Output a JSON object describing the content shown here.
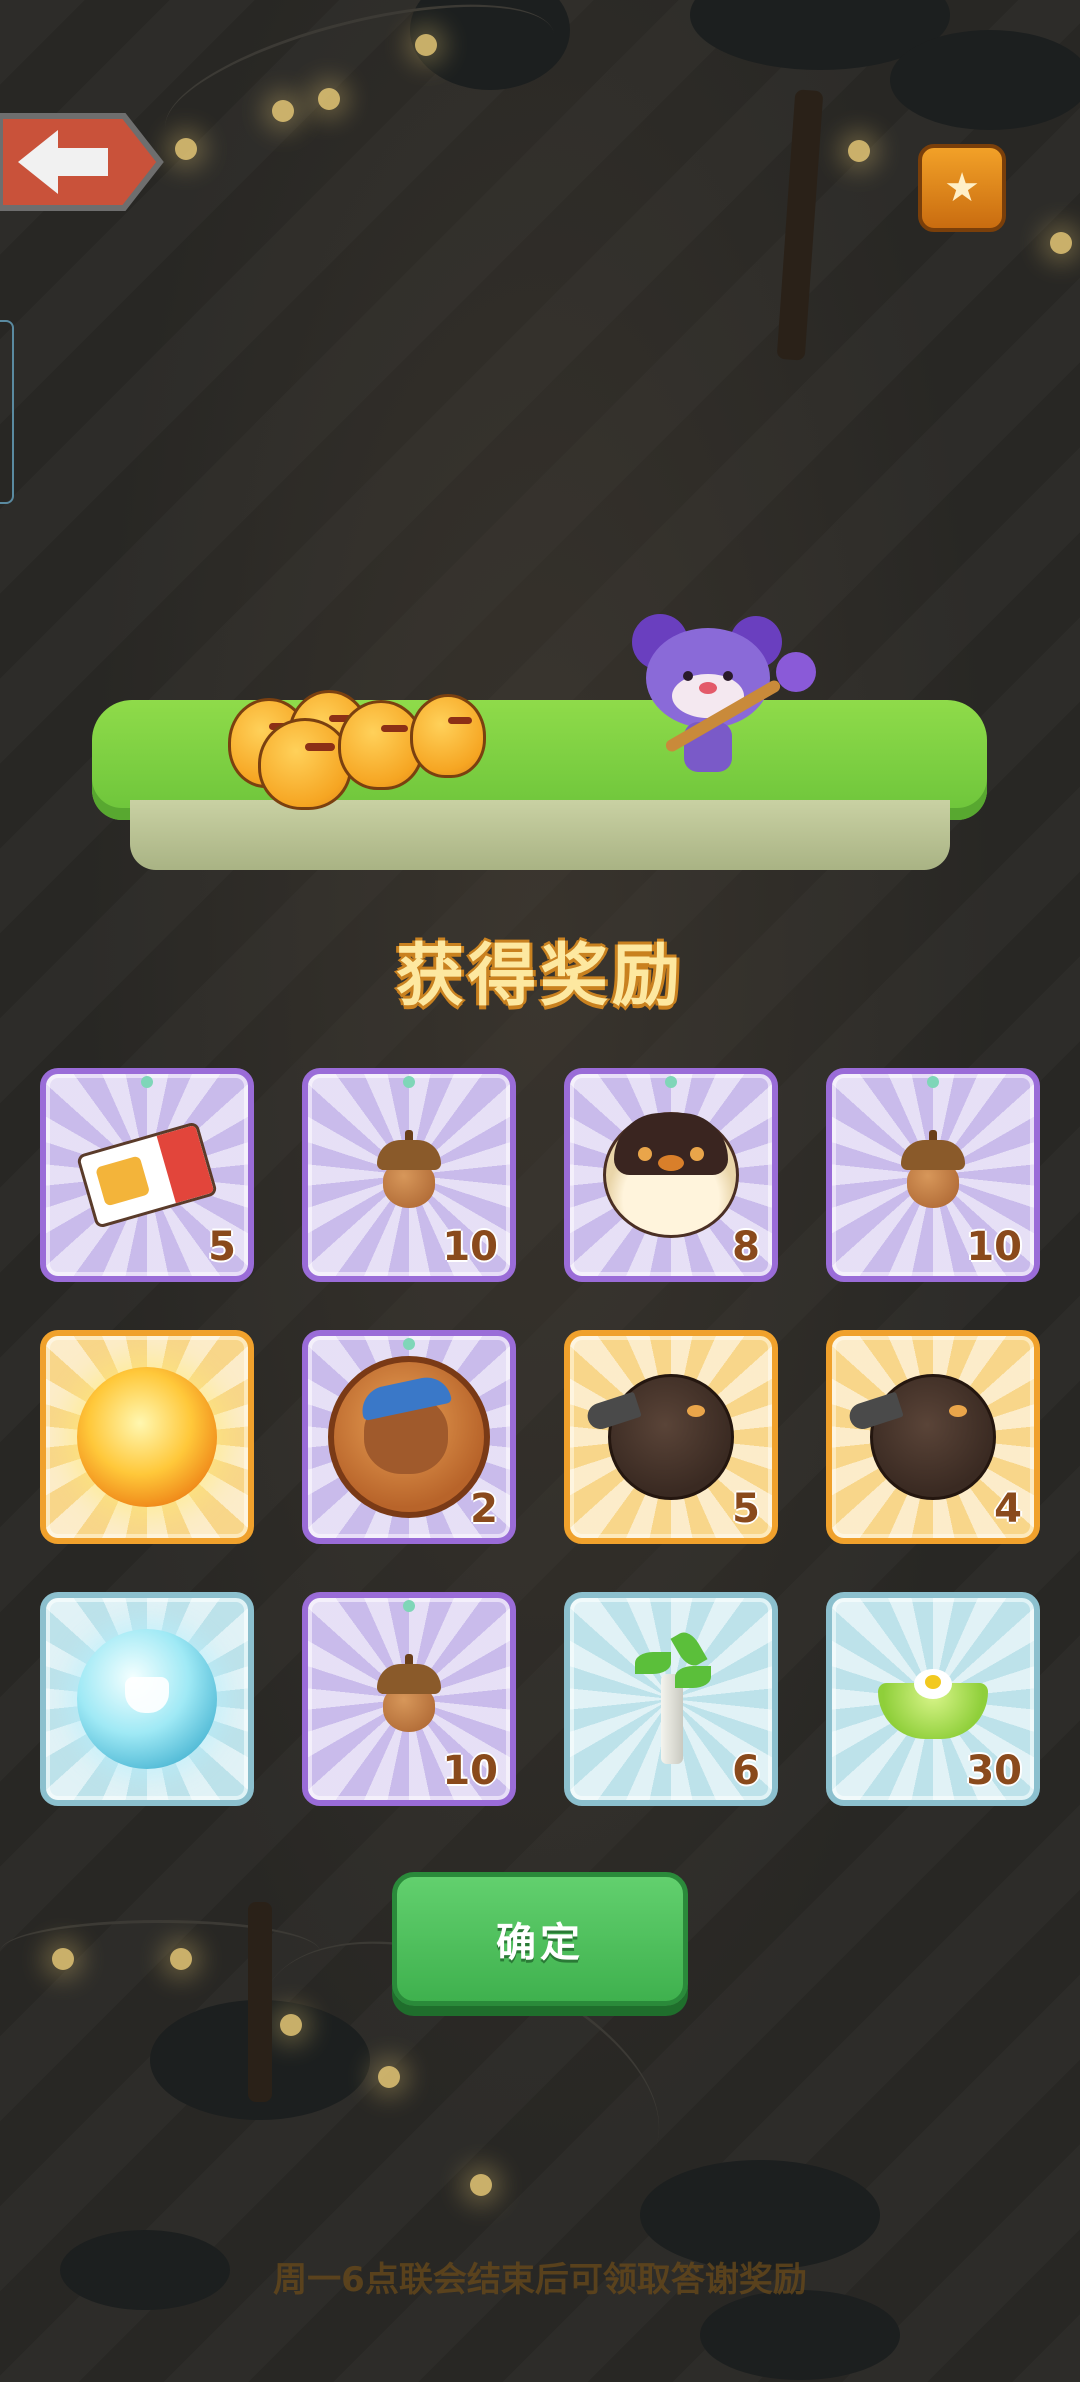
{
  "title": "获得奖励",
  "rewards": [
    {
      "icon": "ticket-icon",
      "frame": "purple",
      "count": "5"
    },
    {
      "icon": "acorn-icon",
      "frame": "purple",
      "count": "10"
    },
    {
      "icon": "hamster-icon",
      "frame": "purple",
      "count": "8"
    },
    {
      "icon": "acorn-icon",
      "frame": "purple",
      "count": "10"
    },
    {
      "icon": "golden-orb-icon",
      "frame": "orange",
      "count": ""
    },
    {
      "icon": "bear-coin-icon",
      "frame": "purple",
      "count": "2"
    },
    {
      "icon": "crow-icon",
      "frame": "orange",
      "count": "5"
    },
    {
      "icon": "crow-icon",
      "frame": "orange",
      "count": "4"
    },
    {
      "icon": "crystal-orb-icon",
      "frame": "blue",
      "count": ""
    },
    {
      "icon": "acorn-icon",
      "frame": "purple",
      "count": "10"
    },
    {
      "icon": "sapling-icon",
      "frame": "blue",
      "count": "6"
    },
    {
      "icon": "egg-bowl-icon",
      "frame": "blue",
      "count": "30"
    }
  ],
  "confirm_label": "确定",
  "footer_text": "周一6点联会结束后可领取答谢奖励",
  "colors": {
    "purple_frame": "#9a6cd8",
    "orange_frame": "#f0a12c",
    "blue_frame": "#8cc0ce",
    "confirm": "#3fb14e"
  }
}
